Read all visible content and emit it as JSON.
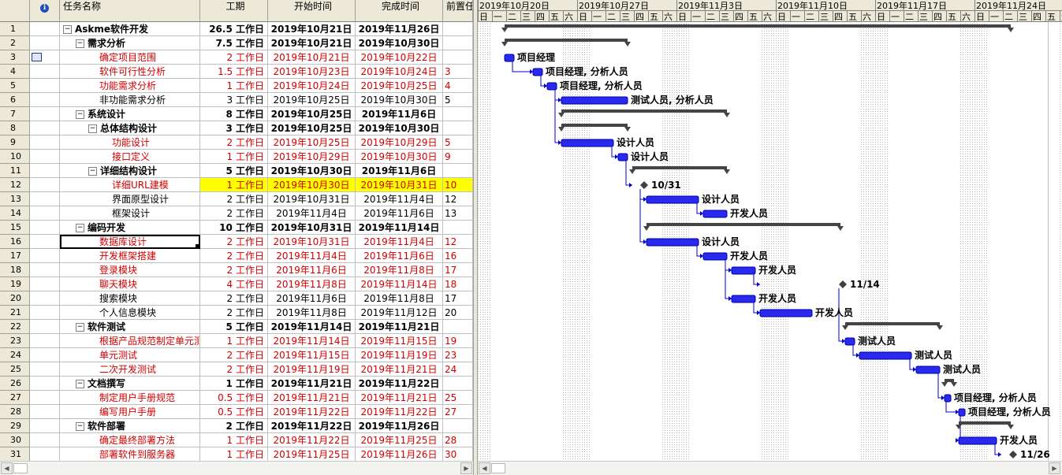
{
  "columns": {
    "info": "ℹ",
    "name": "任务名称",
    "duration": "工期",
    "start": "开始时间",
    "finish": "完成时间",
    "pred": "前置任"
  },
  "timescale": {
    "weeks": [
      "2019年10月20日",
      "2019年10月27日",
      "2019年11月3日",
      "2019年11月10日",
      "2019年11月17日",
      "2019年11月24日"
    ],
    "days": [
      "日",
      "一",
      "二",
      "三",
      "四",
      "五",
      "六"
    ]
  },
  "tasks": [
    {
      "id": "1",
      "name": "Askme软件开发",
      "level": 0,
      "summary": true,
      "critical": false,
      "duration": "26.5 工作日",
      "start": "2019年10月21日",
      "finish": "2019年11月26日",
      "pred": ""
    },
    {
      "id": "2",
      "name": "需求分析",
      "level": 1,
      "summary": true,
      "critical": false,
      "duration": "7.5 工作日",
      "start": "2019年10月21日",
      "finish": "2019年10月30日",
      "pred": ""
    },
    {
      "id": "3",
      "name": "确定项目范围",
      "level": 2,
      "summary": false,
      "critical": true,
      "duration": "2 工作日",
      "start": "2019年10月21日",
      "finish": "2019年10月22日",
      "pred": "",
      "resources": "项目经理"
    },
    {
      "id": "4",
      "name": "软件可行性分析",
      "level": 2,
      "summary": false,
      "critical": true,
      "duration": "1.5 工作日",
      "start": "2019年10月23日",
      "finish": "2019年10月24日",
      "pred": "3",
      "resources": "项目经理, 分析人员"
    },
    {
      "id": "5",
      "name": "功能需求分析",
      "level": 2,
      "summary": false,
      "critical": true,
      "duration": "1 工作日",
      "start": "2019年10月24日",
      "finish": "2019年10月25日",
      "pred": "4",
      "resources": "项目经理, 分析人员"
    },
    {
      "id": "6",
      "name": "非功能需求分析",
      "level": 2,
      "summary": false,
      "critical": false,
      "duration": "3 工作日",
      "start": "2019年10月25日",
      "finish": "2019年10月30日",
      "pred": "5",
      "resources": "测试人员, 分析人员"
    },
    {
      "id": "7",
      "name": "系统设计",
      "level": 1,
      "summary": true,
      "critical": false,
      "duration": "8 工作日",
      "start": "2019年10月25日",
      "finish": "2019年11月6日",
      "pred": ""
    },
    {
      "id": "8",
      "name": "总体结构设计",
      "level": 2,
      "summary": true,
      "critical": false,
      "duration": "3 工作日",
      "start": "2019年10月25日",
      "finish": "2019年10月30日",
      "pred": ""
    },
    {
      "id": "9",
      "name": "功能设计",
      "level": 3,
      "summary": false,
      "critical": true,
      "duration": "2 工作日",
      "start": "2019年10月25日",
      "finish": "2019年10月29日",
      "pred": "5",
      "resources": "设计人员"
    },
    {
      "id": "10",
      "name": "接口定义",
      "level": 3,
      "summary": false,
      "critical": true,
      "duration": "1 工作日",
      "start": "2019年10月29日",
      "finish": "2019年10月30日",
      "pred": "9",
      "resources": "设计人员"
    },
    {
      "id": "11",
      "name": "详细结构设计",
      "level": 2,
      "summary": true,
      "critical": false,
      "duration": "5 工作日",
      "start": "2019年10月30日",
      "finish": "2019年11月6日",
      "pred": ""
    },
    {
      "id": "12",
      "name": "详细URL建模",
      "level": 3,
      "summary": false,
      "critical": true,
      "highlight": true,
      "duration": "1 工作日",
      "start": "2019年10月30日",
      "finish": "2019年10月31日",
      "pred": "10",
      "resources": "10/31"
    },
    {
      "id": "13",
      "name": "界面原型设计",
      "level": 3,
      "summary": false,
      "critical": false,
      "duration": "2 工作日",
      "start": "2019年10月31日",
      "finish": "2019年11月4日",
      "pred": "12",
      "resources": "设计人员"
    },
    {
      "id": "14",
      "name": "框架设计",
      "level": 3,
      "summary": false,
      "critical": false,
      "duration": "2 工作日",
      "start": "2019年11月4日",
      "finish": "2019年11月6日",
      "pred": "13",
      "resources": "开发人员"
    },
    {
      "id": "15",
      "name": "编码开发",
      "level": 1,
      "summary": true,
      "critical": false,
      "duration": "10 工作日",
      "start": "2019年10月31日",
      "finish": "2019年11月14日",
      "pred": ""
    },
    {
      "id": "16",
      "name": "数据库设计",
      "level": 2,
      "summary": false,
      "critical": true,
      "selected": true,
      "duration": "2 工作日",
      "start": "2019年10月31日",
      "finish": "2019年11月4日",
      "pred": "12",
      "resources": "设计人员"
    },
    {
      "id": "17",
      "name": "开发框架搭建",
      "level": 2,
      "summary": false,
      "critical": true,
      "duration": "2 工作日",
      "start": "2019年11月4日",
      "finish": "2019年11月6日",
      "pred": "16",
      "resources": "开发人员"
    },
    {
      "id": "18",
      "name": "登录模块",
      "level": 2,
      "summary": false,
      "critical": true,
      "duration": "2 工作日",
      "start": "2019年11月6日",
      "finish": "2019年11月8日",
      "pred": "17",
      "resources": "开发人员"
    },
    {
      "id": "19",
      "name": "聊天模块",
      "level": 2,
      "summary": false,
      "critical": true,
      "duration": "4 工作日",
      "start": "2019年11月8日",
      "finish": "2019年11月14日",
      "pred": "18",
      "resources": "11/14"
    },
    {
      "id": "20",
      "name": "搜索模块",
      "level": 2,
      "summary": false,
      "critical": false,
      "duration": "2 工作日",
      "start": "2019年11月6日",
      "finish": "2019年11月8日",
      "pred": "17",
      "resources": "开发人员"
    },
    {
      "id": "21",
      "name": "个人信息模块",
      "level": 2,
      "summary": false,
      "critical": false,
      "duration": "2 工作日",
      "start": "2019年11月8日",
      "finish": "2019年11月12日",
      "pred": "20",
      "resources": "开发人员"
    },
    {
      "id": "22",
      "name": "软件测试",
      "level": 1,
      "summary": true,
      "critical": false,
      "duration": "5 工作日",
      "start": "2019年11月14日",
      "finish": "2019年11月21日",
      "pred": ""
    },
    {
      "id": "23",
      "name": "根据产品规范制定单元测",
      "level": 2,
      "summary": false,
      "critical": true,
      "duration": "1 工作日",
      "start": "2019年11月14日",
      "finish": "2019年11月15日",
      "pred": "19",
      "resources": "测试人员"
    },
    {
      "id": "24",
      "name": "单元测试",
      "level": 2,
      "summary": false,
      "critical": true,
      "duration": "2 工作日",
      "start": "2019年11月15日",
      "finish": "2019年11月19日",
      "pred": "23",
      "resources": "测试人员"
    },
    {
      "id": "25",
      "name": "二次开发测试",
      "level": 2,
      "summary": false,
      "critical": true,
      "duration": "2 工作日",
      "start": "2019年11月19日",
      "finish": "2019年11月21日",
      "pred": "24",
      "resources": "测试人员"
    },
    {
      "id": "26",
      "name": "文档撰写",
      "level": 1,
      "summary": true,
      "critical": false,
      "duration": "1 工作日",
      "start": "2019年11月21日",
      "finish": "2019年11月22日",
      "pred": ""
    },
    {
      "id": "27",
      "name": "制定用户手册规范",
      "level": 2,
      "summary": false,
      "critical": true,
      "duration": "0.5 工作日",
      "start": "2019年11月21日",
      "finish": "2019年11月21日",
      "pred": "25",
      "resources": "项目经理, 分析人员"
    },
    {
      "id": "28",
      "name": "编写用户手册",
      "level": 2,
      "summary": false,
      "critical": true,
      "duration": "0.5 工作日",
      "start": "2019年11月22日",
      "finish": "2019年11月22日",
      "pred": "27",
      "resources": "项目经理, 分析人员"
    },
    {
      "id": "29",
      "name": "软件部署",
      "level": 1,
      "summary": true,
      "critical": false,
      "duration": "2 工作日",
      "start": "2019年11月22日",
      "finish": "2019年11月26日",
      "pred": ""
    },
    {
      "id": "30",
      "name": "确定最终部署方法",
      "level": 2,
      "summary": false,
      "critical": true,
      "duration": "1 工作日",
      "start": "2019年11月22日",
      "finish": "2019年11月25日",
      "pred": "28",
      "resources": "开发人员"
    },
    {
      "id": "31",
      "name": "部署软件到服务器",
      "level": 2,
      "summary": false,
      "critical": true,
      "duration": "1 工作日",
      "start": "2019年11月25日",
      "finish": "2019年11月26日",
      "pred": "30",
      "resources": "11/26"
    }
  ],
  "colors": {
    "critical_text": "#d00000",
    "task_bar": "#2a2aef",
    "summary_bar": "#444444",
    "highlight": "#ffff00",
    "link": "#0000cc"
  }
}
